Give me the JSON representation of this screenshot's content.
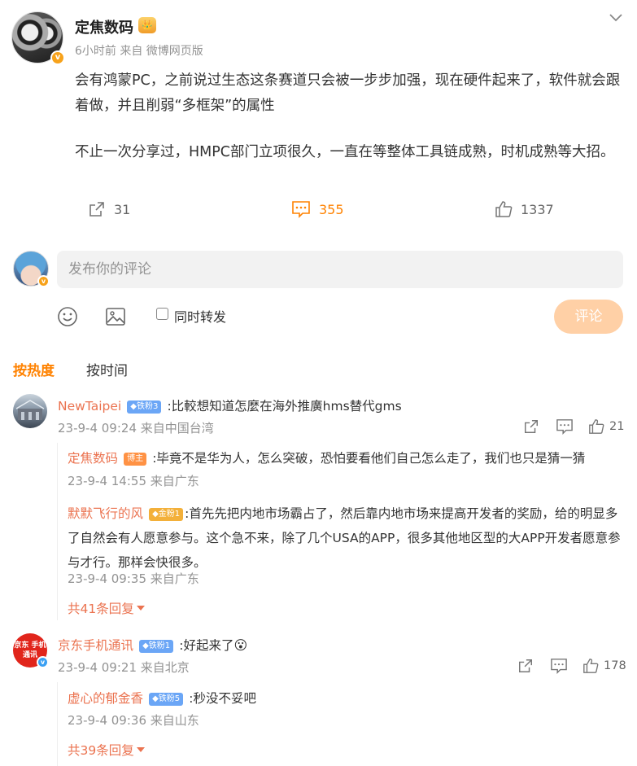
{
  "post": {
    "author": "定焦数码",
    "meta": "6小时前 来自 微博网页版",
    "verified_mark": "v",
    "crown_glyph": "👑",
    "paragraph1": "会有鸿蒙PC，之前说过生态这条赛道只会被一步步加强，现在硬件起来了，软件就会跟着做，并且削弱“多框架”的属性",
    "paragraph2": "不止一次分享过，HMPC部门立项很久，一直在等整体工具链成熟，时机成熟等大招。",
    "actions": {
      "repost": "31",
      "comment": "355",
      "like": "1337"
    }
  },
  "compose": {
    "placeholder": "发布你的评论",
    "repost_label": "同时转发",
    "submit": "评论"
  },
  "tabs": {
    "hot": "按热度",
    "time": "按时间"
  },
  "comments": [
    {
      "name": "NewTaipei",
      "badge": "◆铁粉3",
      "text": ":比較想知道怎麼在海外推廣hms替代gms",
      "meta": "23-9-4 09:24 来自中国台湾",
      "likes": "21",
      "replies": [
        {
          "name": "定焦数码",
          "badge": "博主",
          "text": ":毕竟不是华为人，怎么突破，恐怕要看他们自己怎么走了，我们也只是猜一猜",
          "meta": "23-9-4 14:55 来自广东"
        },
        {
          "name": "默默飞行的风",
          "badge": "◆金粉1",
          "text": ":首先先把内地市场霸占了，然后靠内地市场来提高开发者的奖励，给的明显多了自然会有人愿意参与。这个急不来，除了几个USA的APP，很多其他地区型的大APP开发者愿意参与才行。那样会快很多。",
          "meta": "23-9-4 09:35 来自广东"
        }
      ],
      "more": "共41条回复"
    },
    {
      "name": "京东手机通讯",
      "badge": "◆铁粉1",
      "text": ":好起来了",
      "emoji": "😮",
      "avatar_text": "京东 手机通讯",
      "meta": "23-9-4 09:21 来自北京",
      "likes": "178",
      "replies": [
        {
          "name": "虚心的郁金香",
          "badge": "◆铁粉5",
          "text": ":秒没不妥吧",
          "meta": "23-9-4 09:36 来自山东"
        }
      ],
      "more": "共39条回复"
    }
  ],
  "colors": {
    "accent": "#ff8200",
    "name": "#eb7350",
    "muted": "#939393",
    "submit_bg": "#ffd0a6"
  },
  "icons": [
    "chevron-down-icon",
    "repost-icon",
    "comment-icon",
    "like-icon",
    "emoji-icon",
    "image-icon",
    "caret-down-icon"
  ]
}
